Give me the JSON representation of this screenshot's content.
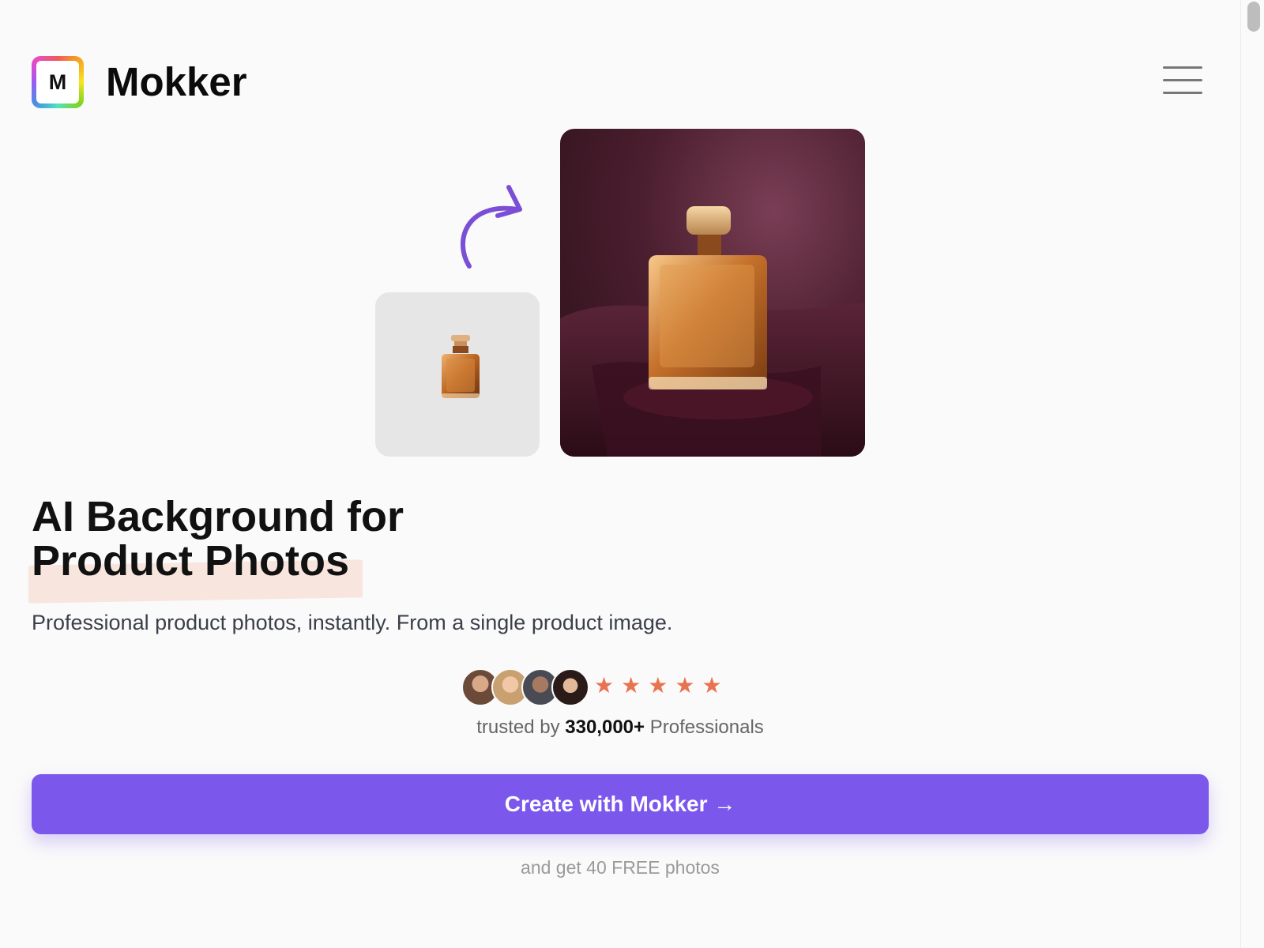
{
  "header": {
    "logo_letter": "M",
    "brand": "Mokker",
    "menu_icon": "hamburger-menu-icon"
  },
  "hero": {
    "arrow_icon": "curved-arrow-icon",
    "before_image": "perfume-bottle-plain-background",
    "after_image": "perfume-bottle-ai-background",
    "headline_line1": "AI Background for",
    "headline_line2": "Product Photos",
    "subtitle": "Professional product photos, instantly. From a single product image."
  },
  "social_proof": {
    "avatar_count": 4,
    "rating": 5,
    "stars": [
      "★",
      "★",
      "★",
      "★",
      "★"
    ],
    "trusted_prefix": "trusted by",
    "trusted_count": "330,000+",
    "trusted_suffix": "Professionals"
  },
  "cta": {
    "label": "Create with Mokker →",
    "note": "and get 40 FREE photos"
  },
  "colors": {
    "accent": "#7b57ec",
    "star": "#e8734f",
    "highlight": "#f8e6de",
    "background": "#fafafa"
  }
}
